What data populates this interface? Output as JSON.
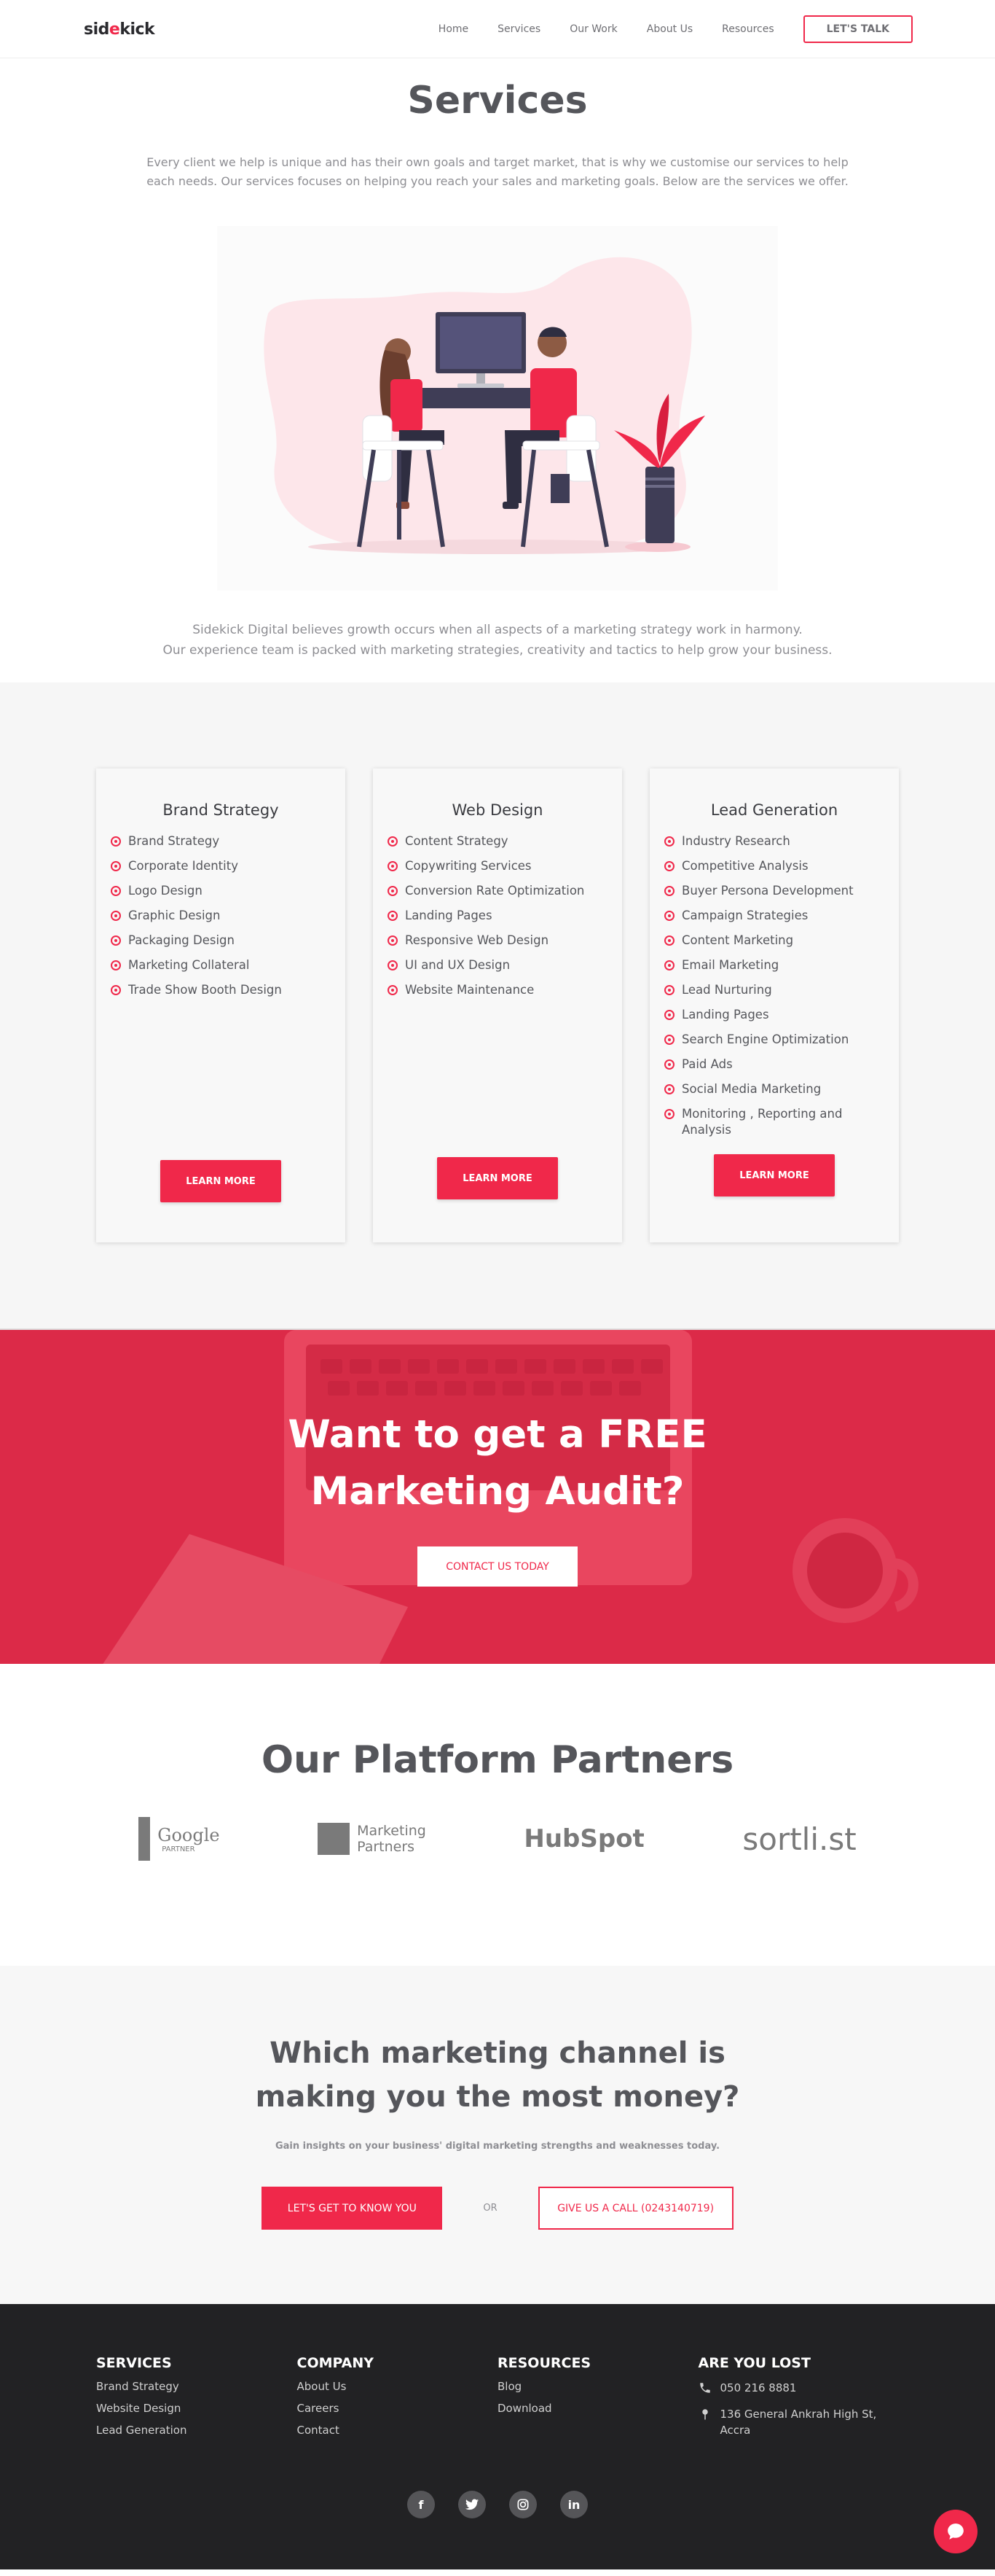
{
  "header": {
    "logo_pre": "sid",
    "logo_dot": "e",
    "logo_post": "kick",
    "nav": [
      "Home",
      "Services",
      "Our Work",
      "About Us",
      "Resources"
    ],
    "cta": "LET'S TALK"
  },
  "services": {
    "title": "Services",
    "intro": "Every client we help is unique and has their own goals and target market, that is why we customise our services to help each needs. Our services focuses on helping you reach your sales and marketing goals. Below are the services we offer.",
    "tagline_1": "Sidekick Digital believes growth occurs when all aspects of a marketing strategy work in harmony.",
    "tagline_2": "Our experience team is packed with marketing strategies, creativity and tactics to help grow your business."
  },
  "cards": [
    {
      "title": "Brand Strategy",
      "items": [
        "Brand Strategy",
        "Corporate Identity",
        "Logo Design",
        "Graphic Design",
        "Packaging Design",
        "Marketing Collateral",
        "Trade Show Booth Design"
      ],
      "button": "LEARN MORE"
    },
    {
      "title": "Web Design",
      "items": [
        "Content Strategy",
        "Copywriting Services",
        "Conversion Rate Optimization",
        "Landing Pages",
        "Responsive Web Design",
        "UI and UX Design",
        "Website Maintenance"
      ],
      "button": "LEARN MORE"
    },
    {
      "title": "Lead Generation",
      "items": [
        "Industry Research",
        "Competitive Analysis",
        "Buyer Persona Development",
        "Campaign Strategies",
        "Content Marketing",
        "Email Marketing",
        "Lead Nurturing",
        "Landing Pages",
        "Search Engine Optimization",
        "Paid Ads",
        "Social Media Marketing",
        "Monitoring , Reporting and Analysis"
      ],
      "button": "LEARN MORE"
    }
  ],
  "audit": {
    "line1": "Want to get a FREE",
    "line2": "Marketing Audit?",
    "button": "CONTACT US TODAY"
  },
  "partners": {
    "title": "Our Platform Partners",
    "google_1": "Google",
    "google_2": "PARTNER",
    "marketing_1": "Marketing",
    "marketing_2": "Partners",
    "hubspot": "HubSpot",
    "sortlist": "sortli.st"
  },
  "cta": {
    "title": "Which marketing channel is making you the most money?",
    "sub": "Gain insights on your business' digital marketing strengths and weaknesses today.",
    "btn_know": "LET'S GET TO KNOW YOU",
    "or": "OR",
    "btn_call": "GIVE US A CALL (0243140719)"
  },
  "footer": {
    "services": {
      "title": "SERVICES",
      "links": [
        "Brand Strategy",
        "Website Design",
        "Lead Generation"
      ]
    },
    "company": {
      "title": "COMPANY",
      "links": [
        "About Us",
        "Careers",
        "Contact"
      ]
    },
    "resources": {
      "title": "RESOURCES",
      "links": [
        "Blog",
        "Download"
      ]
    },
    "lost": {
      "title": "ARE YOU LOST",
      "phone": "050 216 8881",
      "address": "136 General Ankrah High St, Accra"
    },
    "social": [
      "f",
      "t",
      "ig",
      "in"
    ]
  },
  "colors": {
    "accent": "#f0284a",
    "text": "#55565b",
    "footer_bg": "#222224"
  }
}
